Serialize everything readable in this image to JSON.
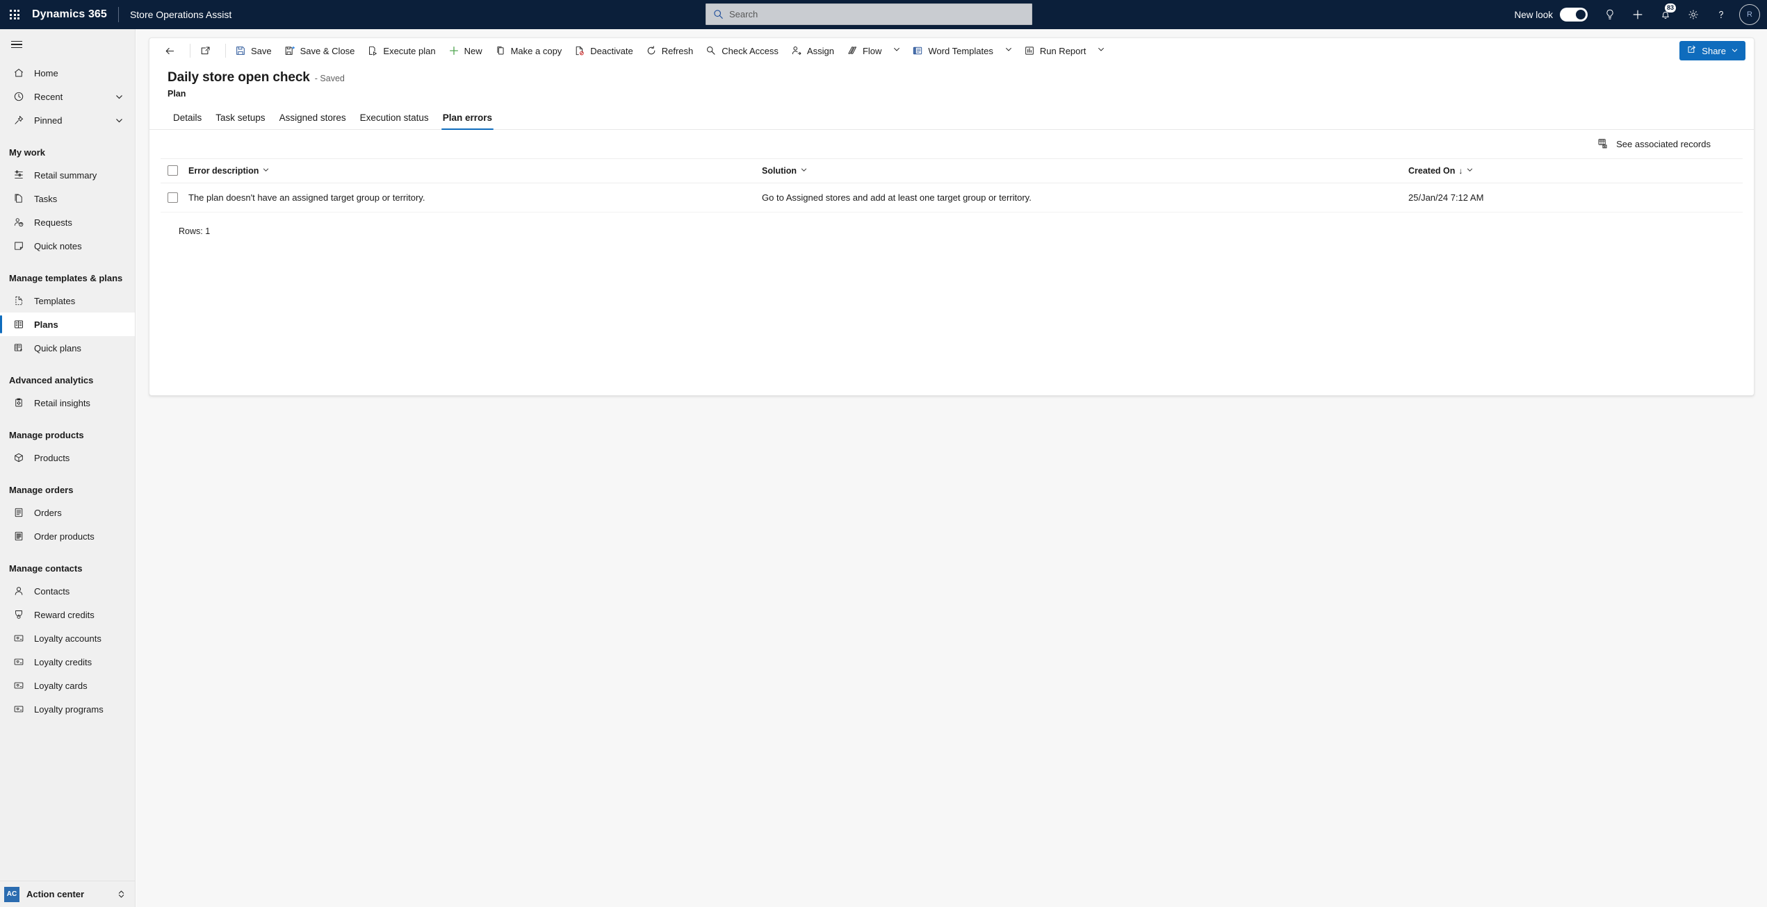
{
  "header": {
    "waffle_label": "app-launcher",
    "brand": "Dynamics 365",
    "app_name": "Store Operations Assist",
    "search_placeholder": "Search",
    "search_value": "",
    "new_look_label": "New look",
    "new_look_on": true,
    "notification_count": "83",
    "avatar_initials": "R",
    "icons": {
      "search": "search-icon",
      "lightbulb": "lightbulb-icon",
      "plus": "plus-icon",
      "bell": "notification-bell-icon",
      "gear": "settings-gear-icon",
      "help": "help-question-icon"
    }
  },
  "sidebar": {
    "hamburger_label": "site-map-toggle",
    "top_items": [
      {
        "label": "Home",
        "icon": "home-icon",
        "chevron": false
      },
      {
        "label": "Recent",
        "icon": "clock-icon",
        "chevron": true
      },
      {
        "label": "Pinned",
        "icon": "pin-icon",
        "chevron": true
      }
    ],
    "groups": [
      {
        "title": "My work",
        "items": [
          {
            "label": "Retail summary",
            "icon": "dashboard-icon",
            "active": false
          },
          {
            "label": "Tasks",
            "icon": "task-page-icon",
            "active": false
          },
          {
            "label": "Requests",
            "icon": "contact-help-icon",
            "active": false
          },
          {
            "label": "Quick notes",
            "icon": "note-icon",
            "active": false
          }
        ]
      },
      {
        "title": "Manage templates & plans",
        "items": [
          {
            "label": "Templates",
            "icon": "template-icon",
            "active": false
          },
          {
            "label": "Plans",
            "icon": "plan-grid-icon",
            "active": true
          },
          {
            "label": "Quick plans",
            "icon": "quick-plan-icon",
            "active": false
          }
        ]
      },
      {
        "title": "Advanced analytics",
        "items": [
          {
            "label": "Retail insights",
            "icon": "insights-icon",
            "active": false
          }
        ]
      },
      {
        "title": "Manage products",
        "items": [
          {
            "label": "Products",
            "icon": "product-box-icon",
            "active": false
          }
        ]
      },
      {
        "title": "Manage orders",
        "items": [
          {
            "label": "Orders",
            "icon": "order-doc-icon",
            "active": false
          },
          {
            "label": "Order products",
            "icon": "order-product-icon",
            "active": false
          }
        ]
      },
      {
        "title": "Manage contacts",
        "items": [
          {
            "label": "Contacts",
            "icon": "person-icon",
            "active": false
          },
          {
            "label": "Reward credits",
            "icon": "medal-icon",
            "active": false
          },
          {
            "label": "Loyalty accounts",
            "icon": "loyalty-card-icon",
            "active": false
          },
          {
            "label": "Loyalty credits",
            "icon": "loyalty-card-icon",
            "active": false
          },
          {
            "label": "Loyalty cards",
            "icon": "loyalty-card-icon",
            "active": false
          },
          {
            "label": "Loyalty programs",
            "icon": "loyalty-card-icon",
            "active": false
          }
        ]
      }
    ],
    "action_center": {
      "badge": "AC",
      "label": "Action center",
      "chevron_icon": "expand-collapse-icon"
    }
  },
  "command_bar": {
    "back_icon": "back-arrow-icon",
    "popout_icon": "open-in-new-window-icon",
    "items": [
      {
        "label": "Save",
        "icon": "save-icon",
        "chevron": false
      },
      {
        "label": "Save & Close",
        "icon": "save-close-icon",
        "chevron": false
      },
      {
        "label": "Execute plan",
        "icon": "execute-plan-icon",
        "chevron": false
      },
      {
        "label": "New",
        "icon": "plus-icon",
        "chevron": false
      },
      {
        "label": "Make a copy",
        "icon": "copy-icon",
        "chevron": false
      },
      {
        "label": "Deactivate",
        "icon": "deactivate-icon",
        "chevron": false
      },
      {
        "label": "Refresh",
        "icon": "refresh-icon",
        "chevron": false
      },
      {
        "label": "Check Access",
        "icon": "check-access-icon",
        "chevron": false
      },
      {
        "label": "Assign",
        "icon": "assign-user-icon",
        "chevron": false
      },
      {
        "label": "Flow",
        "icon": "flow-icon",
        "chevron": true
      },
      {
        "label": "Word Templates",
        "icon": "word-template-icon",
        "chevron": true
      },
      {
        "label": "Run Report",
        "icon": "run-report-icon",
        "chevron": true
      }
    ],
    "share": {
      "label": "Share",
      "icon": "share-icon",
      "chevron": true
    }
  },
  "record": {
    "title": "Daily store open check",
    "saved_status": "- Saved",
    "entity": "Plan"
  },
  "tabs": [
    {
      "label": "Details",
      "active": false
    },
    {
      "label": "Task setups",
      "active": false
    },
    {
      "label": "Assigned stores",
      "active": false
    },
    {
      "label": "Execution status",
      "active": false
    },
    {
      "label": "Plan errors",
      "active": true
    }
  ],
  "grid": {
    "associated_records_label": "See associated records",
    "associated_records_icon": "associated-records-icon",
    "columns": [
      {
        "label": "Error description",
        "sorted": false
      },
      {
        "label": "Solution",
        "sorted": false
      },
      {
        "label": "Created On",
        "sorted": true,
        "sort_dir": "↓"
      }
    ],
    "rows": [
      {
        "error_description": "The plan doesn't have an assigned target group or territory.",
        "solution": "Go to Assigned stores and add at least one target group or territory.",
        "created_on": "25/Jan/24 7:12 AM"
      }
    ],
    "rows_footer": "Rows: 1"
  },
  "colors": {
    "header_bg": "#0b1f3a",
    "accent": "#0f6cbd",
    "sidebar_bg": "#f0f0f0",
    "canvas_bg": "#f7f7f7",
    "card_bg": "#ffffff",
    "text": "#1b1b1b"
  }
}
